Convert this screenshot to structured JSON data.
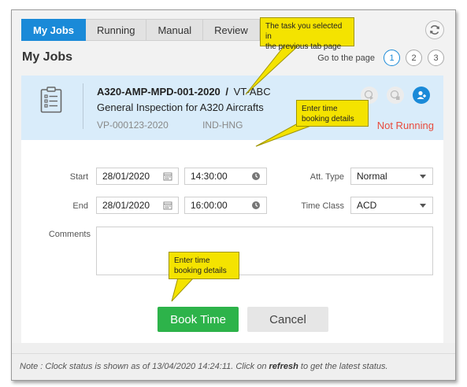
{
  "tabs": [
    {
      "label": "My Jobs",
      "active": true
    },
    {
      "label": "Running",
      "active": false
    },
    {
      "label": "Manual",
      "active": false
    },
    {
      "label": "Review",
      "active": false
    }
  ],
  "page_title": "My Jobs",
  "pager": {
    "label": "Go to the page",
    "pages": [
      "1",
      "2",
      "3"
    ],
    "current": "1"
  },
  "job": {
    "code": "A320-AMP-MPD-001-2020",
    "separator": "/",
    "aircraft": "VT-ABC",
    "description": "General Inspection for A320 Aircrafts",
    "ref": "VP-000123-2020",
    "location": "IND-HNG",
    "status": "Not Running",
    "status_color": "#e84b3c"
  },
  "form": {
    "start_label": "Start",
    "start_date": "28/01/2020",
    "start_time": "14:30:00",
    "end_label": "End",
    "end_date": "28/01/2020",
    "end_time": "16:00:00",
    "att_type_label": "Att. Type",
    "att_type_value": "Normal",
    "time_class_label": "Time Class",
    "time_class_value": "ACD",
    "comments_label": "Comments",
    "comments_value": ""
  },
  "buttons": {
    "book": "Book Time",
    "cancel": "Cancel"
  },
  "note": {
    "prefix": "Note : Clock status is shown as of 13/04/2020  14:24:11. Click on ",
    "link": "refresh",
    "suffix": " to get the latest status."
  },
  "callouts": {
    "tab": [
      "The task you selected in",
      "the previous tab page"
    ],
    "booking_top": [
      "Enter time",
      "booking details"
    ],
    "booking_bottom": [
      "Enter time",
      "booking details"
    ]
  },
  "colors": {
    "accent": "#1a8ad8",
    "book": "#2db34a",
    "callout": "#f4e300",
    "job_bg": "#d9ecfa"
  },
  "icons": [
    "refresh-icon",
    "clipboard-icon",
    "calendar-icon",
    "clock-icon",
    "dropdown-caret-icon",
    "user-add-icon"
  ]
}
